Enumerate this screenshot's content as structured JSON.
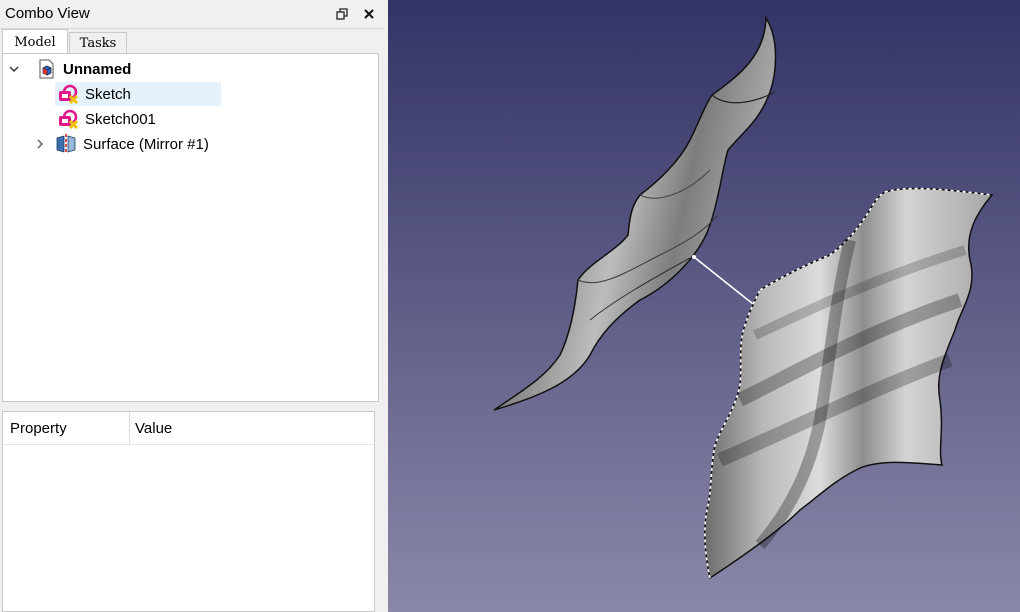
{
  "combo_view": {
    "title": "Combo View",
    "float_icon": "restore-window-icon",
    "close_icon": "close-icon"
  },
  "tabs": [
    {
      "label": "Model",
      "active": true
    },
    {
      "label": "Tasks",
      "active": false
    }
  ],
  "tree": {
    "root": {
      "label": "Unnamed",
      "icon": "document-icon",
      "expanded": true
    },
    "items": [
      {
        "label": "Sketch",
        "icon": "sketch-icon",
        "selected": true
      },
      {
        "label": "Sketch001",
        "icon": "sketch-icon",
        "selected": false
      },
      {
        "label": "Surface (Mirror #1)",
        "icon": "mirror-icon",
        "selected": false,
        "collapsed": true
      }
    ]
  },
  "property_view": {
    "columns": [
      "Property",
      "Value"
    ]
  },
  "viewport": {
    "background_top": "#333366",
    "background_bottom": "#8a88a8",
    "surface_color": "#a8a8a8"
  }
}
